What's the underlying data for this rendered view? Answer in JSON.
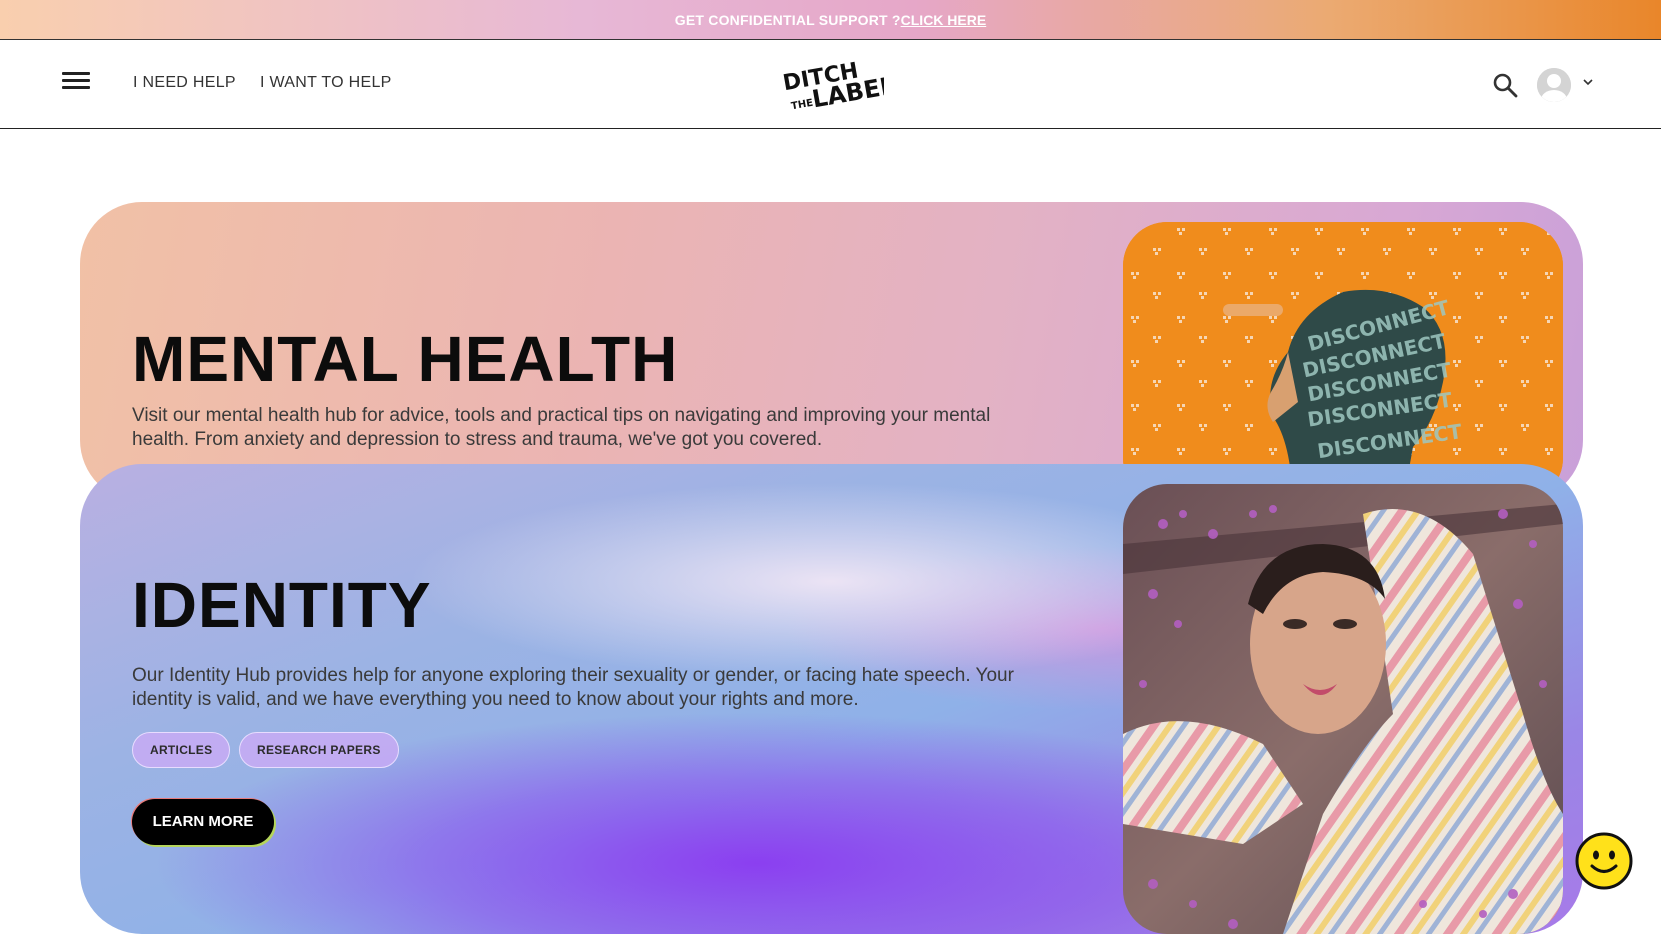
{
  "banner": {
    "text": "GET CONFIDENTIAL SUPPORT ?",
    "link": "CLICK HERE"
  },
  "header": {
    "nav": [
      "I NEED HELP",
      "I WANT TO HELP"
    ],
    "logo": {
      "line1": "DITCH",
      "line2": "THE",
      "line3": "LABEL"
    }
  },
  "cards": {
    "mental_health": {
      "title": "MENTAL HEALTH",
      "description": "Visit our mental health hub for advice, tools and practical tips on navigating and improving your mental health. From anxiety and depression to stress and trauma, we've got you covered.",
      "image_text": [
        "DISCONNECT",
        "DISCONNECT",
        "DISCONNECT",
        "DISCONNECT",
        "DISCONNECT"
      ]
    },
    "identity": {
      "title": "IDENTITY",
      "description": "Our Identity Hub provides help for anyone exploring their sexuality or gender, or facing hate speech. Your identity is valid, and we have everything you need to know about your rights and more.",
      "tags": [
        "ARTICLES",
        "RESEARCH PAPERS"
      ],
      "cta": "LEARN MORE"
    }
  },
  "colors": {
    "banner_accent": "#e9862a",
    "orange_photo_bg": "#f08c1c",
    "cta_bg": "#000000",
    "smiley": "#ffe11a"
  },
  "icons": [
    "hamburger-menu-icon",
    "search-icon",
    "avatar-icon",
    "chevron-down-icon",
    "smiley-chat-icon"
  ]
}
